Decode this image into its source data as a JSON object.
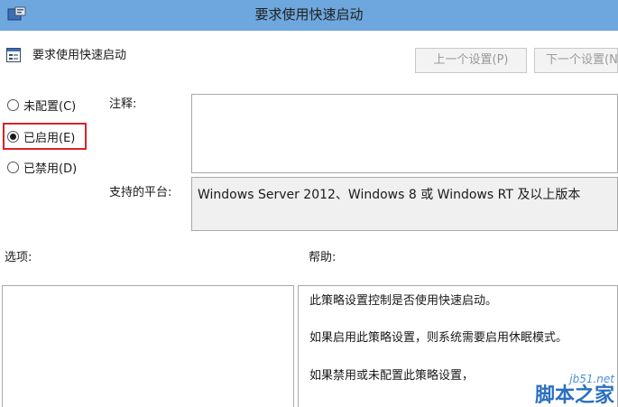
{
  "window": {
    "title": "要求使用快速启动"
  },
  "header": {
    "policy_name": "要求使用快速启动",
    "prev_button": "上一个设置(P)",
    "next_button": "下一个设置(N)"
  },
  "state_options": [
    {
      "label": "未配置(C)",
      "checked": false
    },
    {
      "label": "已启用(E)",
      "checked": true
    },
    {
      "label": "已禁用(D)",
      "checked": false
    }
  ],
  "comment": {
    "label": "注释:",
    "value": ""
  },
  "platform": {
    "label": "支持的平台:",
    "value": "Windows Server 2012、Windows 8 或 Windows RT 及以上版本"
  },
  "options_section": {
    "label": "选项:"
  },
  "help_section": {
    "label": "帮助:",
    "lines": [
      "此策略设置控制是否使用快速启动。",
      "如果启用此策略设置，则系统需要启用休眠模式。",
      "如果禁用或未配置此策略设置，"
    ]
  },
  "watermark": {
    "site": "jb51.net",
    "name": "脚本之家"
  },
  "colors": {
    "titlebar": "#6ea7dd",
    "highlight": "#d8232a"
  }
}
